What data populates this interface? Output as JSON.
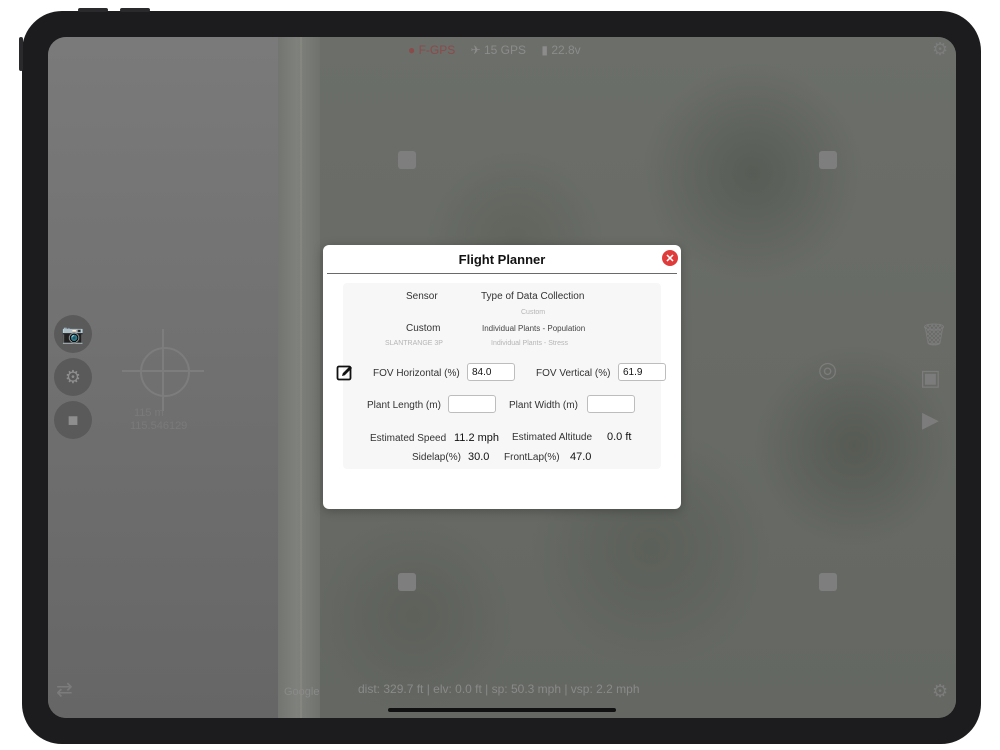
{
  "status_bar": {
    "fgps_label": "F-GPS",
    "gps_count": "15 GPS",
    "battery": "22.8v"
  },
  "bottom_bar": {
    "telemetry": "dist: 329.7 ft | elv: 0.0 ft | sp: 50.3 mph | vsp: 2.2 mph",
    "map_attribution": "Google"
  },
  "left_pane": {
    "coords_line1": "115 m",
    "coords_line2": "115.546129"
  },
  "modal": {
    "title": "Flight Planner",
    "close_icon": "close-icon",
    "sensor_header": "Sensor",
    "type_header": "Type of Data Collection",
    "type_faint": "Custom",
    "sensor_value": "Custom",
    "sensor_faint": "SLANTRANGE 3P",
    "type_value": "Individual Plants - Population",
    "type_faint2": "Individual Plants - Stress",
    "fov_horizontal_label": "FOV Horizontal (%)",
    "fov_horizontal_value": "84.0",
    "fov_vertical_label": "FOV Vertical (%)",
    "fov_vertical_value": "61.9",
    "plant_length_label": "Plant Length (m)",
    "plant_length_value": "",
    "plant_width_label": "Plant Width (m)",
    "plant_width_value": "",
    "est_speed_label": "Estimated Speed",
    "est_speed_value": "11.2 mph",
    "est_altitude_label": "Estimated Altitude",
    "est_altitude_value": "0.0 ft",
    "sidelap_label": "Sidelap(%)",
    "sidelap_value": "30.0",
    "frontlap_label": "FrontLap(%)",
    "frontlap_value": "47.0"
  },
  "colors": {
    "close_button": "#e03b3b",
    "device_frame": "#1c1c1e"
  }
}
